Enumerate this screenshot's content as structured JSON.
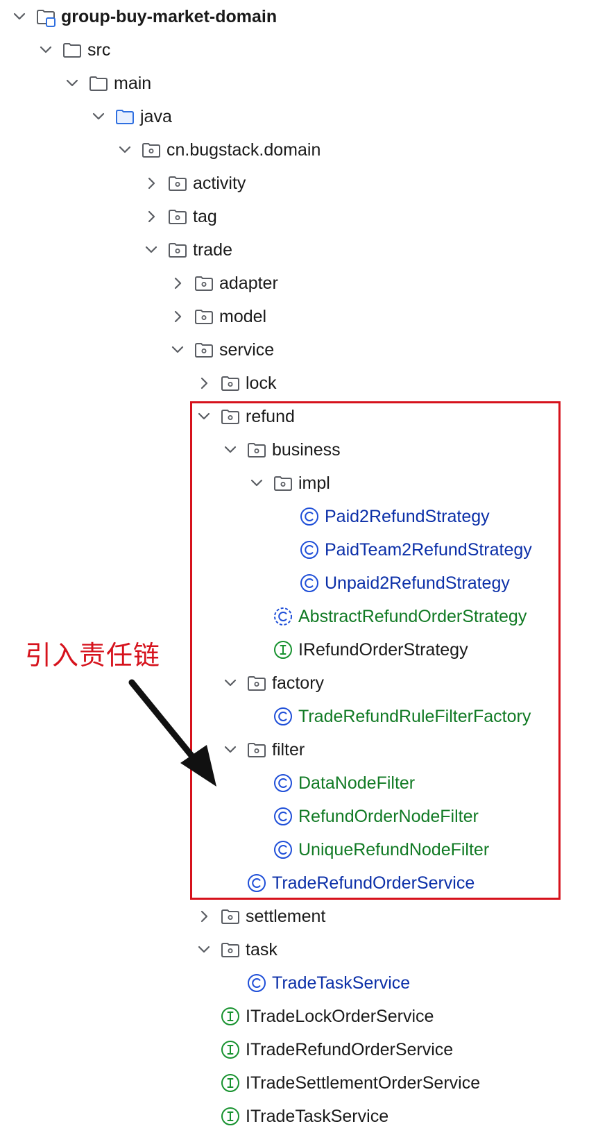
{
  "tree": [
    {
      "label": "group-buy-market-domain",
      "depth": 0,
      "chevron": "down",
      "icon": "module-icon",
      "style": "bold"
    },
    {
      "label": "src",
      "depth": 1,
      "chevron": "down",
      "icon": "folder-icon",
      "style": "normal"
    },
    {
      "label": "main",
      "depth": 2,
      "chevron": "down",
      "icon": "folder-icon",
      "style": "normal"
    },
    {
      "label": "java",
      "depth": 3,
      "chevron": "down",
      "icon": "source-folder-icon",
      "style": "normal"
    },
    {
      "label": "cn.bugstack.domain",
      "depth": 4,
      "chevron": "down",
      "icon": "package-icon",
      "style": "normal"
    },
    {
      "label": "activity",
      "depth": 5,
      "chevron": "right",
      "icon": "package-icon",
      "style": "normal"
    },
    {
      "label": "tag",
      "depth": 5,
      "chevron": "right",
      "icon": "package-icon",
      "style": "normal"
    },
    {
      "label": "trade",
      "depth": 5,
      "chevron": "down",
      "icon": "package-icon",
      "style": "normal"
    },
    {
      "label": "adapter",
      "depth": 6,
      "chevron": "right",
      "icon": "package-icon",
      "style": "normal"
    },
    {
      "label": "model",
      "depth": 6,
      "chevron": "right",
      "icon": "package-icon",
      "style": "normal"
    },
    {
      "label": "service",
      "depth": 6,
      "chevron": "down",
      "icon": "package-icon",
      "style": "normal"
    },
    {
      "label": "lock",
      "depth": 7,
      "chevron": "right",
      "icon": "package-icon",
      "style": "normal"
    },
    {
      "label": "refund",
      "depth": 7,
      "chevron": "down",
      "icon": "package-icon",
      "style": "normal"
    },
    {
      "label": "business",
      "depth": 8,
      "chevron": "down",
      "icon": "package-icon",
      "style": "normal"
    },
    {
      "label": "impl",
      "depth": 9,
      "chevron": "down",
      "icon": "package-icon",
      "style": "normal"
    },
    {
      "label": "Paid2RefundStrategy",
      "depth": 10,
      "chevron": "none",
      "icon": "class-icon",
      "style": "blue"
    },
    {
      "label": "PaidTeam2RefundStrategy",
      "depth": 10,
      "chevron": "none",
      "icon": "class-icon",
      "style": "blue"
    },
    {
      "label": "Unpaid2RefundStrategy",
      "depth": 10,
      "chevron": "none",
      "icon": "class-icon",
      "style": "blue"
    },
    {
      "label": "AbstractRefundOrderStrategy",
      "depth": 9,
      "chevron": "none",
      "icon": "abstract-class-icon",
      "style": "green"
    },
    {
      "label": "IRefundOrderStrategy",
      "depth": 9,
      "chevron": "none",
      "icon": "interface-icon",
      "style": "normal"
    },
    {
      "label": "factory",
      "depth": 8,
      "chevron": "down",
      "icon": "package-icon",
      "style": "normal"
    },
    {
      "label": "TradeRefundRuleFilterFactory",
      "depth": 9,
      "chevron": "none",
      "icon": "class-icon",
      "style": "green"
    },
    {
      "label": "filter",
      "depth": 8,
      "chevron": "down",
      "icon": "package-icon",
      "style": "normal"
    },
    {
      "label": "DataNodeFilter",
      "depth": 9,
      "chevron": "none",
      "icon": "class-icon",
      "style": "green"
    },
    {
      "label": "RefundOrderNodeFilter",
      "depth": 9,
      "chevron": "none",
      "icon": "class-icon",
      "style": "green"
    },
    {
      "label": "UniqueRefundNodeFilter",
      "depth": 9,
      "chevron": "none",
      "icon": "class-icon",
      "style": "green"
    },
    {
      "label": "TradeRefundOrderService",
      "depth": 8,
      "chevron": "none",
      "icon": "class-icon",
      "style": "blue"
    },
    {
      "label": "settlement",
      "depth": 7,
      "chevron": "right",
      "icon": "package-icon",
      "style": "normal"
    },
    {
      "label": "task",
      "depth": 7,
      "chevron": "down",
      "icon": "package-icon",
      "style": "normal"
    },
    {
      "label": "TradeTaskService",
      "depth": 8,
      "chevron": "none",
      "icon": "class-icon",
      "style": "blue"
    },
    {
      "label": "ITradeLockOrderService",
      "depth": 7,
      "chevron": "none",
      "icon": "interface-icon",
      "style": "normal"
    },
    {
      "label": "ITradeRefundOrderService",
      "depth": 7,
      "chevron": "none",
      "icon": "interface-icon",
      "style": "normal"
    },
    {
      "label": "ITradeSettlementOrderService",
      "depth": 7,
      "chevron": "none",
      "icon": "interface-icon",
      "style": "normal"
    },
    {
      "label": "ITradeTaskService",
      "depth": 7,
      "chevron": "none",
      "icon": "interface-icon",
      "style": "normal"
    }
  ],
  "annotation": {
    "text": "引入责任链",
    "color": "#d6121c"
  },
  "colors": {
    "class_icon": "#1f4fd8",
    "interface_icon": "#17922f",
    "folder_outline": "#5a5d63",
    "source_folder": "#2f6fe0",
    "chevron": "#5a5d63",
    "label_blue": "#0b2fa8",
    "label_green": "#117a24"
  }
}
